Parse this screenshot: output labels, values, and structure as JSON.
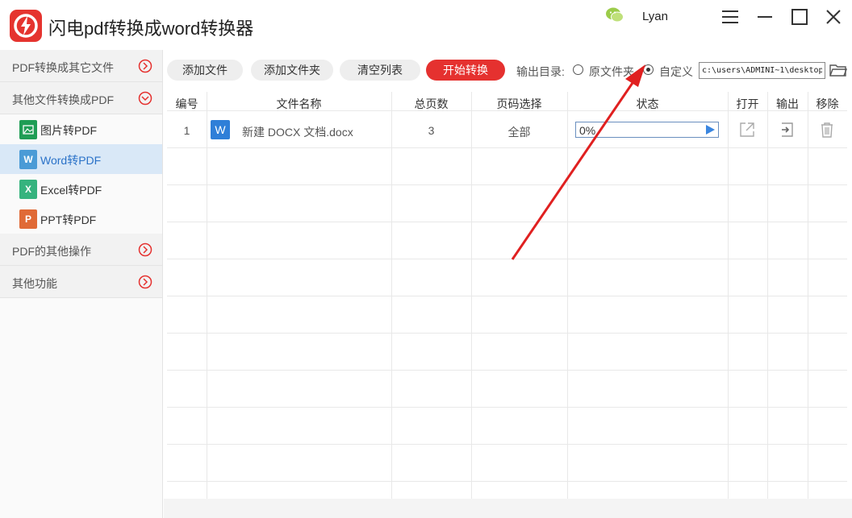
{
  "app": {
    "title": "闪电pdf转换成word转换器",
    "user": "Lyan"
  },
  "colors": {
    "accent": "#e5312f",
    "active_bg": "#d9e8f7",
    "link_blue": "#2a72c8",
    "annotation_arrow": "#e02020"
  },
  "sidebar": {
    "groups": [
      {
        "label": "PDF转换成其它文件",
        "icon": "chevron-right-circle-icon"
      },
      {
        "label": "其他文件转换成PDF",
        "icon": "chevron-down-circle-icon"
      },
      {
        "label": "PDF的其他操作",
        "icon": "chevron-right-circle-icon"
      },
      {
        "label": "其他功能",
        "icon": "chevron-right-circle-icon"
      }
    ],
    "items": [
      {
        "label": "图片转PDF",
        "icon": "image-file-icon",
        "color": "#1f9d55",
        "active": false
      },
      {
        "label": "Word转PDF",
        "icon": "word-file-icon",
        "color": "#4a9bd6",
        "active": true
      },
      {
        "label": "Excel转PDF",
        "icon": "excel-file-icon",
        "color": "#36b37e",
        "active": false
      },
      {
        "label": "PPT转PDF",
        "icon": "ppt-file-icon",
        "color": "#e06a36",
        "active": false
      }
    ],
    "item_glyphs": [
      "",
      "W",
      "X",
      "P"
    ]
  },
  "toolbar": {
    "add_file": "添加文件",
    "add_folder": "添加文件夹",
    "clear_list": "清空列表",
    "start": "开始转换",
    "output_label": "输出目录:",
    "option_source": "原文件夹",
    "option_custom": "自定义",
    "output_path": "c:\\users\\ADMINI~1\\desktop"
  },
  "table": {
    "headers": [
      "编号",
      "文件名称",
      "总页数",
      "页码选择",
      "状态",
      "打开",
      "输出",
      "移除"
    ],
    "rows": [
      {
        "index": "1",
        "file_icon": "W",
        "filename": "新建 DOCX 文档.docx",
        "pages": "3",
        "page_selection": "全部",
        "status": "0%",
        "progress": 0
      }
    ]
  }
}
